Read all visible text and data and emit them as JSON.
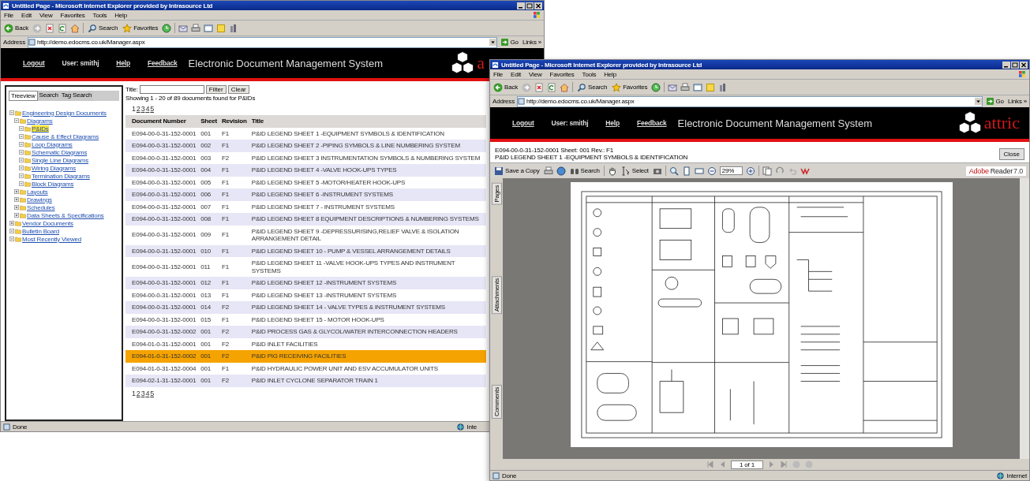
{
  "left_window": {
    "title": "Untitled Page - Microsoft Internet Explorer provided by Intrasource Ltd",
    "menu": [
      "File",
      "Edit",
      "View",
      "Favorites",
      "Tools",
      "Help"
    ],
    "toolbar": {
      "back": "Back",
      "search": "Search",
      "favorites": "Favorites"
    },
    "address": {
      "label": "Address",
      "url": "http://demo.edocms.co.uk/Manager.aspx",
      "go": "Go",
      "links": "Links »"
    },
    "header": {
      "logout": "Logout",
      "user": "User: smithj",
      "help": "Help",
      "feedback": "Feedback",
      "app_title": "Electronic Document Management System",
      "logo_text": "a"
    },
    "tabs": [
      {
        "label": "Treeview",
        "selected": true
      },
      {
        "label": "Search",
        "selected": false
      },
      {
        "label": "Tag Search",
        "selected": false
      }
    ],
    "tree": [
      {
        "label": "Engineering Design Documents",
        "expanded": true,
        "selected": false,
        "children": [
          {
            "label": "Diagrams",
            "expanded": true,
            "selected": false,
            "children": [
              {
                "label": "P&IDs",
                "expanded": true,
                "selected": true
              },
              {
                "label": "Cause & Effect Diagrams",
                "expanded": true,
                "selected": false
              },
              {
                "label": "Loop Diagrams",
                "expanded": true,
                "selected": false
              },
              {
                "label": "Schematic Diagrams",
                "expanded": true,
                "selected": false
              },
              {
                "label": "Single Line Diagrams",
                "expanded": true,
                "selected": false
              },
              {
                "label": "Wiring Diagrams",
                "expanded": true,
                "selected": false
              },
              {
                "label": "Termination Diagrams",
                "expanded": true,
                "selected": false
              },
              {
                "label": "Block Diagrams",
                "expanded": true,
                "selected": false
              }
            ]
          },
          {
            "label": "Layouts",
            "expanded": false,
            "selected": false
          },
          {
            "label": "Drawings",
            "expanded": false,
            "selected": false
          },
          {
            "label": "Schedules",
            "expanded": false,
            "selected": false
          },
          {
            "label": "Data Sheets & Specifications",
            "expanded": false,
            "selected": false
          }
        ]
      },
      {
        "label": "Vendor Documents",
        "expanded": false,
        "selected": false
      },
      {
        "label": "Bulletin Board",
        "expanded": true,
        "selected": false
      },
      {
        "label": "Most Recently Viewed",
        "expanded": true,
        "selected": false
      }
    ],
    "filter": {
      "label": "Title:",
      "filter_button": "Filter",
      "clear_button": "Clear"
    },
    "summary": "Showing 1 - 20 of 89 documents found for P&IDs",
    "pager_top": [
      {
        "label": "1",
        "selected": true
      },
      {
        "label": "2",
        "selected": false
      },
      {
        "label": "3",
        "selected": false
      },
      {
        "label": "4",
        "selected": false
      },
      {
        "label": "5",
        "selected": false
      }
    ],
    "columns": [
      "Document Number",
      "Sheet",
      "Revision",
      "Title"
    ],
    "rows": [
      {
        "number": "E094-00-0-31-152-0001",
        "sheet": "001",
        "revision": "F1",
        "title": "P&ID LEGEND SHEET 1 -EQUIPMENT SYMBOLS & IDENTIFICATION",
        "selected": false
      },
      {
        "number": "E094-00-0-31-152-0001",
        "sheet": "002",
        "revision": "F1",
        "title": "P&ID LEGEND SHEET 2 -PIPING SYMBOLS & LINE NUMBERING SYSTEM",
        "selected": false
      },
      {
        "number": "E094-00-0-31-152-0001",
        "sheet": "003",
        "revision": "F2",
        "title": "P&ID LEGEND SHEET 3 INSTRUMENTATION SYMBOLS & NUMBERING SYSTEM",
        "selected": false
      },
      {
        "number": "E094-00-0-31-152-0001",
        "sheet": "004",
        "revision": "F1",
        "title": "P&ID LEGEND SHEET 4 -VALVE HOOK-UPS TYPES",
        "selected": false
      },
      {
        "number": "E094-00-0-31-152-0001",
        "sheet": "005",
        "revision": "F1",
        "title": "P&ID LEGEND SHEET 5 -MOTOR/HEATER HOOK-UPS",
        "selected": false
      },
      {
        "number": "E094-00-0-31-152-0001",
        "sheet": "006",
        "revision": "F1",
        "title": "P&ID LEGEND SHEET 6 -INSTRUMENT SYSTEMS",
        "selected": false
      },
      {
        "number": "E094-00-0-31-152-0001",
        "sheet": "007",
        "revision": "F1",
        "title": "P&ID LEGEND SHEET 7 - INSTRUMENT SYSTEMS",
        "selected": false
      },
      {
        "number": "E094-00-0-31-152-0001",
        "sheet": "008",
        "revision": "F1",
        "title": "P&ID LEGEND SHEET 8 EQUIPMENT DESCRIPTIONS & NUMBERING SYSTEMS",
        "selected": false
      },
      {
        "number": "E094-00-0-31-152-0001",
        "sheet": "009",
        "revision": "F1",
        "title": "P&ID LEGEND SHEET 9 -DEPRESSURISING,RELIEF VALVE & ISOLATION ARRANGEMENT DETAIL",
        "selected": false
      },
      {
        "number": "E094-00-0-31-152-0001",
        "sheet": "010",
        "revision": "F1",
        "title": "P&ID LEGEND SHEET 10 - PUMP & VESSEL ARRANGEMENT DETAILS",
        "selected": false
      },
      {
        "number": "E094-00-0-31-152-0001",
        "sheet": "011",
        "revision": "F1",
        "title": "P&ID LEGEND SHEET 11 -VALVE HOOK-UPS TYPES AND INSTRUMENT SYSTEMS",
        "selected": false
      },
      {
        "number": "E094-00-0-31-152-0001",
        "sheet": "012",
        "revision": "F1",
        "title": "P&ID LEGEND SHEET 12 -INSTRUMENT SYSTEMS",
        "selected": false
      },
      {
        "number": "E094-00-0-31-152-0001",
        "sheet": "013",
        "revision": "F1",
        "title": "P&ID LEGEND SHEET 13 -INSTRUMENT SYSTEMS",
        "selected": false
      },
      {
        "number": "E094-00-0-31-152-0001",
        "sheet": "014",
        "revision": "F2",
        "title": "P&ID LEGEND SHEET 14 - VALVE TYPES & INSTRUMENT SYSTEMS",
        "selected": false
      },
      {
        "number": "E094-00-0-31-152-0001",
        "sheet": "015",
        "revision": "F1",
        "title": "P&ID LEGEND SHEET 15 - MOTOR HOOK-UPS",
        "selected": false
      },
      {
        "number": "E094-00-0-31-152-0002",
        "sheet": "001",
        "revision": "F2",
        "title": "P&ID PROCESS GAS & GLYCOL/WATER INTERCONNECTION HEADERS",
        "selected": false
      },
      {
        "number": "E094-01-0-31-152-0001",
        "sheet": "001",
        "revision": "F2",
        "title": "P&ID INLET FACILITIES",
        "selected": false
      },
      {
        "number": "E094-01-0-31-152-0002",
        "sheet": "001",
        "revision": "F2",
        "title": "P&ID PIG RECEIVING FACILITIES",
        "selected": true
      },
      {
        "number": "E094-01-0-31-152-0004",
        "sheet": "001",
        "revision": "F1",
        "title": "P&ID HYDRAULIC POWER UNIT AND ESV ACCUMULATOR UNITS",
        "selected": false
      },
      {
        "number": "E094-02-1-31-152-0001",
        "sheet": "001",
        "revision": "F2",
        "title": "P&ID INLET CYCLONE SEPARATOR TRAIN 1",
        "selected": false
      }
    ],
    "pager_bottom": [
      {
        "label": "1",
        "selected": true
      },
      {
        "label": "2",
        "selected": false
      },
      {
        "label": "3",
        "selected": false
      },
      {
        "label": "4",
        "selected": false
      },
      {
        "label": "5",
        "selected": false
      }
    ],
    "status_bar": {
      "text": "Done",
      "zone": "Inte"
    }
  },
  "right_window": {
    "title": "Untitled Page - Microsoft Internet Explorer provided by Intrasource Ltd",
    "menu": [
      "File",
      "Edit",
      "View",
      "Favorites",
      "Tools",
      "Help"
    ],
    "toolbar": {
      "back": "Back",
      "search": "Search",
      "favorites": "Favorites"
    },
    "address": {
      "label": "Address",
      "url": "http://demo.edocms.co.uk/Manager.aspx",
      "go": "Go",
      "links": "Links »"
    },
    "header": {
      "logout": "Logout",
      "user": "User: smithj",
      "help": "Help",
      "feedback": "Feedback",
      "app_title": "Electronic Document Management System",
      "logo_text": "attric"
    },
    "doc_ref": "E094-00-0-31-152-0001 Sheet: 001 Rev.: F1",
    "doc_title": "P&ID LEGEND SHEET 1 -EQUIPMENT SYMBOLS & IDENTIFICATION",
    "close_button": "Close",
    "reader_toolbar": {
      "save": "Save a Copy",
      "search": "Search",
      "select": "Select",
      "zoom": "29%",
      "brand": "Adobe",
      "product": "Reader",
      "version": "7.0"
    },
    "side_tabs": [
      "Pages",
      "Attachments",
      "Comments"
    ],
    "page_nav": "1 of 1",
    "status_bar": {
      "text": "Done",
      "zone": "Internet"
    }
  }
}
